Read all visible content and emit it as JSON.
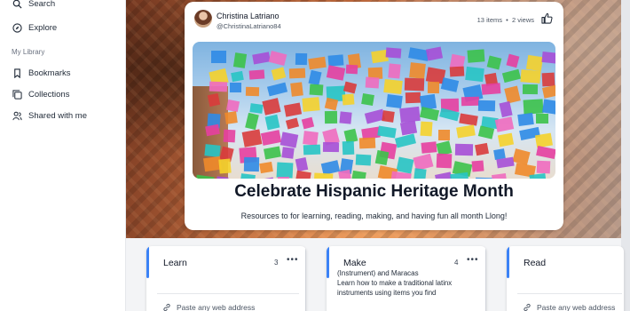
{
  "sidebar": {
    "items_top": [
      {
        "label": "Search",
        "icon": "search-icon"
      },
      {
        "label": "Explore",
        "icon": "compass-icon"
      }
    ],
    "section_label": "My Library",
    "items_library": [
      {
        "label": "Bookmarks",
        "icon": "bookmark-icon"
      },
      {
        "label": "Collections",
        "icon": "collections-icon"
      },
      {
        "label": "Shared with me",
        "icon": "people-icon"
      }
    ]
  },
  "card": {
    "author_name": "Christina Latriano",
    "author_handle": "@ChristinaLatriano84",
    "items": "13 items",
    "separator": "•",
    "views": "2 views",
    "title": "Celebrate Hispanic Heritage Month",
    "subtitle": "Resources to for learning, reading,  making, and having fun all month Llong!"
  },
  "columns": [
    {
      "title": "Learn",
      "count": "3",
      "more": "•••",
      "paste": "Paste any web address"
    },
    {
      "title": "Make",
      "count": "4",
      "more": "•••",
      "note_head": "(Instrument) and Maracas",
      "note": "Learn how to make a traditional latinx instruments using items you find"
    },
    {
      "title": "Read",
      "paste": "Paste any web address"
    }
  ],
  "colors": {
    "accent": "#3b82f6",
    "text": "#1f2937"
  }
}
